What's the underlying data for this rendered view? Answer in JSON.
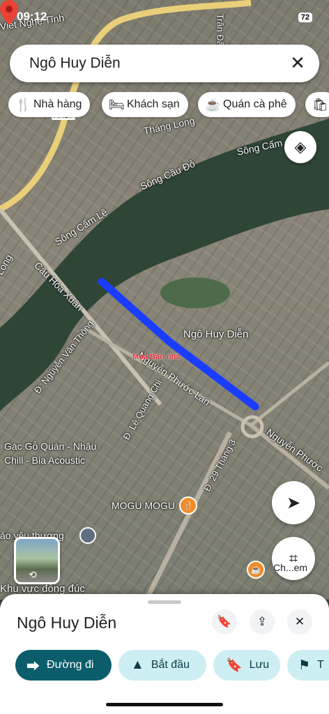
{
  "status_bar": {
    "time": "09:12",
    "battery": "72"
  },
  "search": {
    "query": "Ngô Huy Diễn",
    "clear_icon": "close-icon"
  },
  "chips": [
    {
      "icon": "restaurant-icon",
      "glyph": "🍴",
      "label": "Nhà hàng"
    },
    {
      "icon": "hotel-icon",
      "glyph": "🛏",
      "label": "Khách sạn"
    },
    {
      "icon": "coffee-icon",
      "glyph": "☕",
      "label": "Quán cà phê"
    },
    {
      "icon": "shopping-icon",
      "glyph": "🛍",
      "label": ""
    }
  ],
  "map_labels": {
    "viet_nghe_tinh": "Viết Nghệ Tĩnh",
    "tran_dang": "Trần Đăn",
    "thang_long_top": "Tháng Long",
    "song_cam_right": "Sông Cấm",
    "song_cau_do": "Sông Cầu Đỏ",
    "song_cam_le": "Sông Cẩm Lệ",
    "thang_long_left": "Long",
    "cau_hoa_xuan": "Cầu Hòa Xuân",
    "nguyen_van_thong": "Đ. Nguyễn Văn Thông",
    "le_quang_chi": "Đ. Lê Quang Chi",
    "nguyen_phuoc_lan": "Nguyễn Phước Lan",
    "nguyen_phuoc_right": "Nguyễn Phước",
    "d29_thang_3": "Đ. 29 Tháng 3",
    "khu_vuc": "Khu vực đông đúc",
    "ao_yeu_thuong": "ảo yêu thương",
    "highway": "AH17"
  },
  "pin_label": "Ngô Huy Diễn",
  "pois": {
    "gac_go": "Gác Gỗ Quán - Nhậu Chill - Bia Acoustic",
    "mogu": "MOGU MOGU",
    "coffee_short": "Ch...em"
  },
  "watermark": "Mua Bán nhà",
  "sheet": {
    "title": "Ngô Huy Diễn",
    "actions": [
      {
        "icon": "directions-icon",
        "glyph": "⮕",
        "label": "Đường đi"
      },
      {
        "icon": "navigate-icon",
        "glyph": "▲",
        "label": "Bắt đầu"
      },
      {
        "icon": "bookmark-icon",
        "glyph": "🔖",
        "label": "Lưu"
      },
      {
        "icon": "flag-icon",
        "glyph": "⚑",
        "label": "T"
      }
    ]
  },
  "colors": {
    "route": "#1a3cff",
    "primary": "#0b5d6b",
    "chip_teal": "#cdeff3",
    "pin": "#ea4335"
  }
}
